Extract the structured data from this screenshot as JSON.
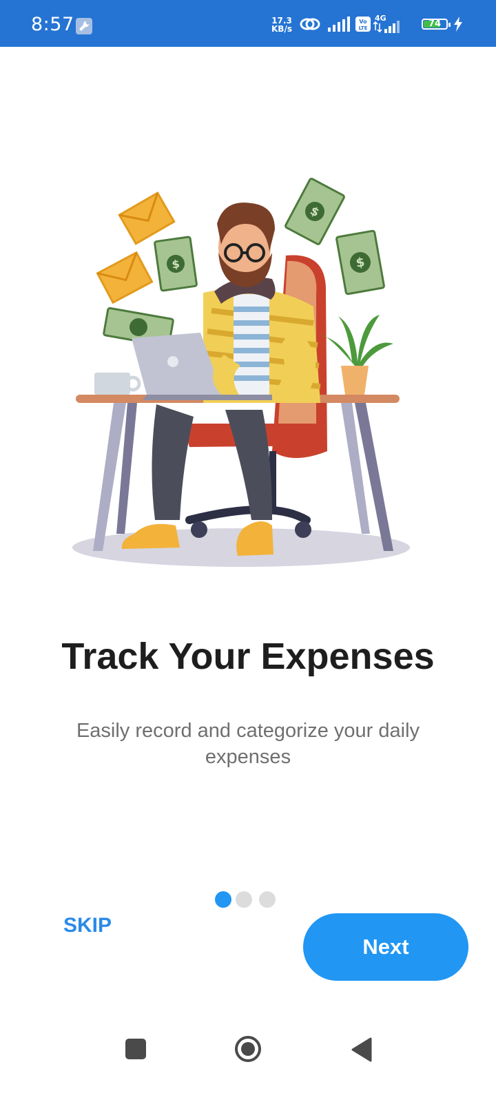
{
  "status_bar": {
    "time": "8:57",
    "speed_value": "17.3",
    "speed_unit": "KB/s",
    "network": "4G",
    "volte": "Vo LTE",
    "battery_level": "74",
    "battery_fraction": 0.74,
    "color": "#2574d4"
  },
  "onboarding": {
    "title": "Track Your Expenses",
    "subtitle": "Easily record and categorize your daily expenses",
    "page_index": 1,
    "page_count": 3,
    "skip_label": "SKIP",
    "next_label": "Next",
    "accent_color": "#2196f3"
  },
  "icons": {
    "status_tool": "wrench-icon",
    "hotspot": "link-icon",
    "signal": "signal-icon",
    "charging": "bolt-icon",
    "nav_recents": "square-icon",
    "nav_home": "circle-icon",
    "nav_back": "triangle-back-icon"
  }
}
